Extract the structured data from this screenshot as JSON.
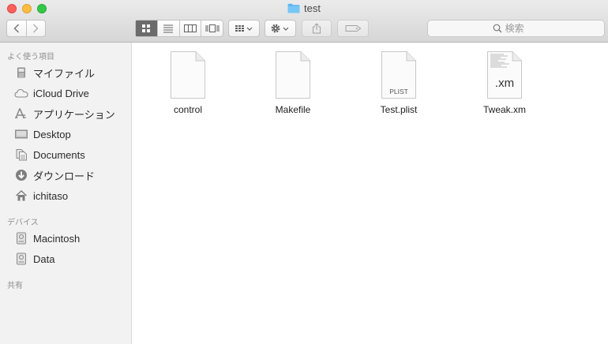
{
  "window": {
    "title": "test"
  },
  "toolbar": {
    "search_placeholder": "検索"
  },
  "sidebar": {
    "favorites_title": "よく使う項目",
    "favorites": [
      {
        "label": "マイファイル",
        "icon": "all-my-files-icon"
      },
      {
        "label": "iCloud Drive",
        "icon": "cloud-icon"
      },
      {
        "label": "アプリケーション",
        "icon": "applications-icon"
      },
      {
        "label": "Desktop",
        "icon": "desktop-icon"
      },
      {
        "label": "Documents",
        "icon": "documents-icon"
      },
      {
        "label": "ダウンロード",
        "icon": "downloads-icon"
      },
      {
        "label": "ichitaso",
        "icon": "home-icon"
      }
    ],
    "devices_title": "デバイス",
    "devices": [
      {
        "label": "Macintosh",
        "icon": "disk-icon"
      },
      {
        "label": "Data",
        "icon": "disk-icon"
      }
    ],
    "shared_title": "共有"
  },
  "files": [
    {
      "name": "control",
      "icon": "document-icon",
      "badge": ""
    },
    {
      "name": "Makefile",
      "icon": "document-icon",
      "badge": ""
    },
    {
      "name": "Test.plist",
      "icon": "plist-document-icon",
      "badge": "PLIST"
    },
    {
      "name": "Tweak.xm",
      "icon": "source-document-icon",
      "badge": ".xm"
    }
  ]
}
